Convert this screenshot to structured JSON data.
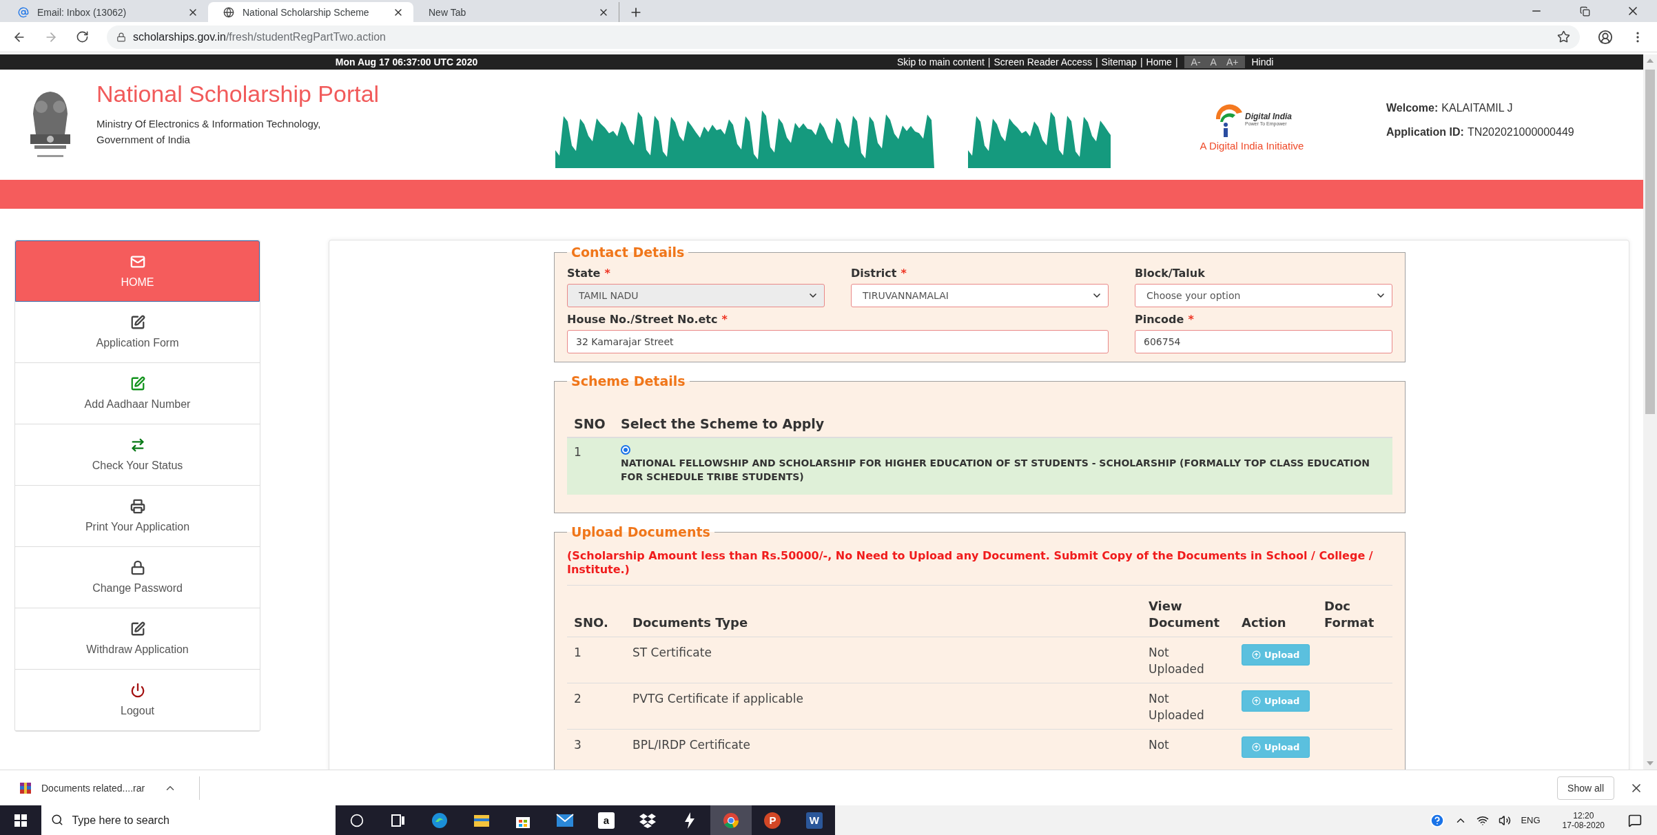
{
  "browser": {
    "tabs": [
      {
        "title": "Email: Inbox (13062)",
        "kind": "email",
        "selected": false
      },
      {
        "title": "National Scholarship Scheme",
        "kind": "web",
        "selected": true
      },
      {
        "title": "New Tab",
        "kind": "blank",
        "selected": false
      }
    ],
    "url_host": "scholarships.gov.in",
    "url_path": "/fresh/studentRegPartTwo.action"
  },
  "top_bar": {
    "date": "Mon Aug 17 06:37:00 UTC 2020",
    "links": [
      "Skip to main content",
      "Screen Reader Access",
      "Sitemap",
      "Home"
    ],
    "separator": "|",
    "font_sizes": [
      "A-",
      "A",
      "A+"
    ],
    "language": "Hindi"
  },
  "header": {
    "title": "National Scholarship Portal",
    "subtitle": [
      "Ministry Of Electronics & Information Technology,",
      "Government of India"
    ],
    "logo_name": "Digital India",
    "logo_tagline": "Power To Empower",
    "initiative": "A Digital India Initiative",
    "welcome_label": "Welcome:",
    "welcome_name": "KALAITAMIL J",
    "app_id_label": "Application ID:",
    "app_id": "TN202021000000449"
  },
  "sidebar": {
    "items": [
      {
        "label": "HOME",
        "kind": "mail",
        "selected": true
      },
      {
        "label": "Application Form",
        "kind": "edit",
        "selected": false
      },
      {
        "label": "Add Aadhaar Number",
        "kind": "add",
        "selected": false
      },
      {
        "label": "Check Your Status",
        "kind": "status",
        "selected": false
      },
      {
        "label": "Print Your Application",
        "kind": "print",
        "selected": false
      },
      {
        "label": "Change Password",
        "kind": "password",
        "selected": false
      },
      {
        "label": "Withdraw Application",
        "kind": "edit",
        "selected": false
      },
      {
        "label": "Logout",
        "kind": "logout",
        "selected": false
      }
    ]
  },
  "contact": {
    "legend": "Contact Details",
    "marker": "*",
    "rows": [
      {
        "fields": [
          {
            "label": "State",
            "required": true,
            "kind": "select",
            "value": "TAMIL NADU",
            "disabled": true
          },
          {
            "label": "District",
            "required": true,
            "kind": "select",
            "value": "TIRUVANNAMALAI",
            "disabled": false
          },
          {
            "label": "Block/Taluk",
            "required": false,
            "kind": "select",
            "value": "Choose your option",
            "disabled": false
          }
        ]
      },
      {
        "fields": [
          {
            "label": "House No./Street No.etc",
            "required": true,
            "kind": "input",
            "value": "32 Kamarajar Street"
          },
          {
            "label": "Pincode",
            "required": true,
            "kind": "input",
            "value": "606754"
          }
        ]
      }
    ]
  },
  "scheme": {
    "legend": "Scheme Details",
    "columns": [
      "SNO",
      "Select the Scheme to Apply"
    ],
    "rows": [
      {
        "sno": "1",
        "name": "NATIONAL FELLOWSHIP AND SCHOLARSHIP FOR HIGHER EDUCATION OF ST STUDENTS - SCHOLARSHIP (FORMALLY TOP CLASS EDUCATION FOR SCHEDULE TRIBE STUDENTS)",
        "selected": true
      }
    ]
  },
  "upload": {
    "legend": "Upload Documents",
    "note": "(Scholarship Amount less than Rs.50000/-, No Need to Upload any Document. Submit Copy of the Documents in School / College / Institute.)",
    "columns": [
      "SNO.",
      "Documents Type",
      "View Document",
      "Action",
      "Doc Format"
    ],
    "rows": [
      {
        "sno": "1",
        "type": "ST Certificate",
        "status": "Not Uploaded",
        "action": "Upload"
      },
      {
        "sno": "2",
        "type": "PVTG Certificate if applicable",
        "status": "Not Uploaded",
        "action": "Upload"
      },
      {
        "sno": "3",
        "type": "BPL/IRDP Certificate",
        "status": "Not",
        "action": "Upload"
      }
    ]
  },
  "download_bar": {
    "file": "Documents related....rar",
    "show_all": "Show all"
  },
  "taskbar": {
    "search_placeholder": "Type here to search",
    "apps": [
      {
        "kind": "cortana",
        "active": false
      },
      {
        "kind": "taskview",
        "active": false
      },
      {
        "kind": "edge",
        "active": false
      },
      {
        "kind": "explorer",
        "active": false
      },
      {
        "kind": "store",
        "active": false
      },
      {
        "kind": "mail",
        "active": false
      },
      {
        "kind": "amazon",
        "glyph": "a",
        "active": false
      },
      {
        "kind": "dropbox",
        "active": false
      },
      {
        "kind": "bolt",
        "active": false
      },
      {
        "kind": "chrome",
        "active": true
      },
      {
        "kind": "powerpoint",
        "glyph": "P",
        "active": false
      },
      {
        "kind": "word",
        "glyph": "W",
        "active": false
      }
    ],
    "language": "ENG",
    "time": "12:20",
    "date": "17-08-2020"
  }
}
